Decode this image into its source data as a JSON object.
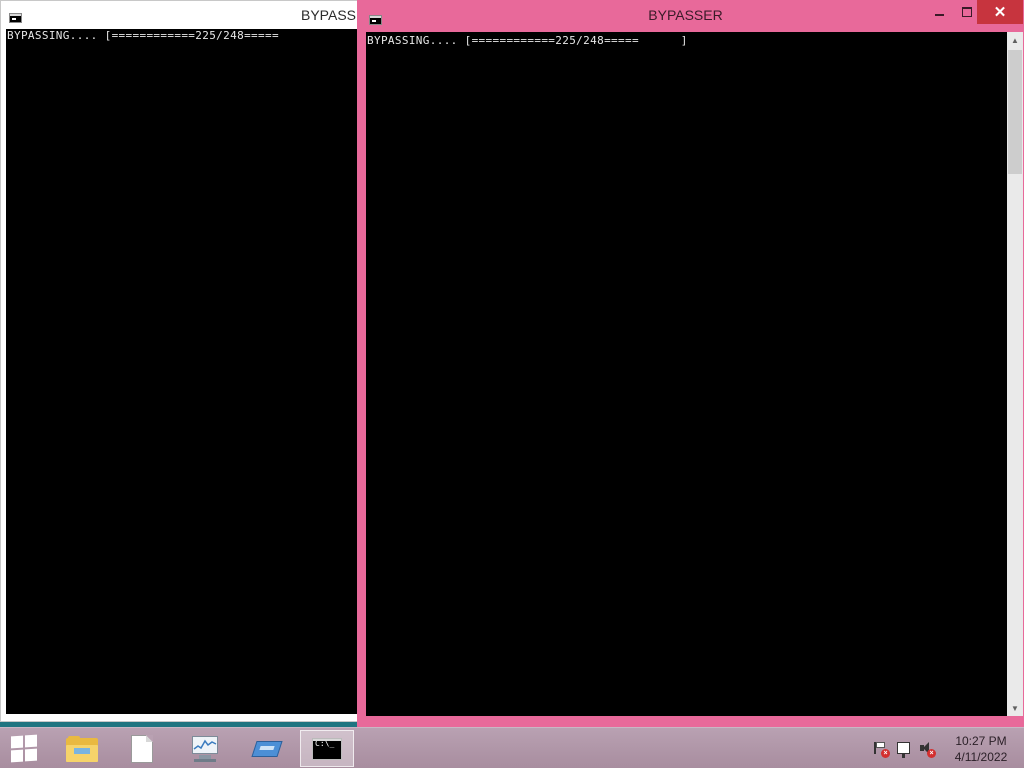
{
  "back_window": {
    "title": "BYPASSER",
    "console_text": "BYPASSING.... [============225/248====="
  },
  "front_window": {
    "title": "BYPASSER",
    "console_text": "BYPASSING.... [============225/248=====      ]",
    "controls": {
      "minimize": "minimize",
      "maximize": "maximize",
      "close": "close"
    }
  },
  "progress": {
    "current": 225,
    "total": 248
  },
  "taskbar": {
    "items": [
      "start",
      "file-explorer",
      "new-file",
      "performance-monitor",
      "server-manager",
      "command-prompt"
    ],
    "active_item": "command-prompt",
    "cmd_icon_text": "C:\\_"
  },
  "tray": {
    "clock_time": "10:27 PM",
    "clock_date": "4/11/2022",
    "icons": [
      "action-center-flag-icon",
      "network-icon",
      "volume-muted-icon"
    ]
  },
  "colors": {
    "active_frame": "#e8699a",
    "console_bg": "#000000",
    "close_button": "#c7343e"
  }
}
